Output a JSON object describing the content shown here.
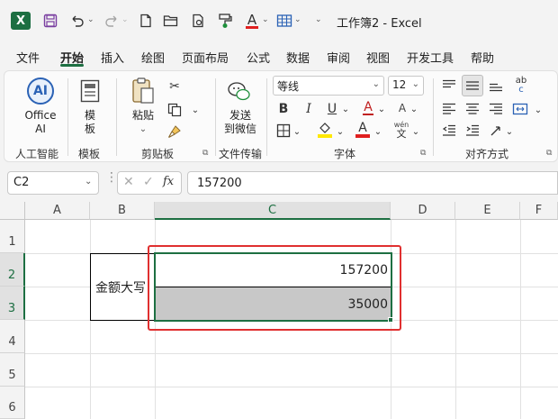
{
  "titlebar": {
    "logo": "X",
    "icons": [
      "save-icon",
      "undo-icon",
      "redo-icon",
      "new-file-icon",
      "open-folder-icon",
      "print-preview-icon",
      "format-painter-icon",
      "font-color-icon",
      "table-icon"
    ],
    "title": "工作簿2 - Excel"
  },
  "tabs": [
    "文件",
    "开始",
    "插入",
    "绘图",
    "页面布局",
    "公式",
    "数据",
    "审阅",
    "视图",
    "开发工具",
    "帮助"
  ],
  "active_tab": "开始",
  "ribbon": {
    "ai": {
      "icon_text": "AI",
      "label_line1": "Office",
      "label_line2": "AI",
      "group": "人工智能"
    },
    "template": {
      "label_line1": "模",
      "label_line2": "板",
      "group": "模板"
    },
    "clipboard": {
      "paste_label": "粘贴",
      "group": "剪贴板"
    },
    "file_transfer": {
      "label_line1": "发送",
      "label_line2": "到微信",
      "group": "文件传输"
    },
    "font": {
      "font_name": "等线",
      "font_size": "12",
      "bold": "B",
      "italic": "I",
      "underline": "U",
      "font_color_letter": "A",
      "highlight_letter": "A",
      "phonetic_top": "wén",
      "phonetic_bottom": "文",
      "grow_letter": "A",
      "shrink_letter": "A",
      "group": "字体"
    },
    "alignment": {
      "group": "对齐方式",
      "wrap_top": "ab",
      "wrap_bottom": "c"
    },
    "colors": {
      "accent": "#1d6f42",
      "font_color": "#e02020",
      "highlight": "#ffe800"
    }
  },
  "formula_bar": {
    "name_box": "C2",
    "cancel": "✕",
    "enter": "✓",
    "fx": "fx",
    "value": "157200"
  },
  "grid": {
    "columns": [
      "A",
      "B",
      "C",
      "D",
      "E",
      "F"
    ],
    "rows": [
      "1",
      "2",
      "3",
      "4",
      "5",
      "6"
    ],
    "cells": {
      "B2": "金额大写",
      "C2": "157200",
      "C3": "35000"
    },
    "colors": {
      "selection": "#1d6f42",
      "highlight_box": "#e03030",
      "c3_fill": "#c8c8c8"
    }
  }
}
